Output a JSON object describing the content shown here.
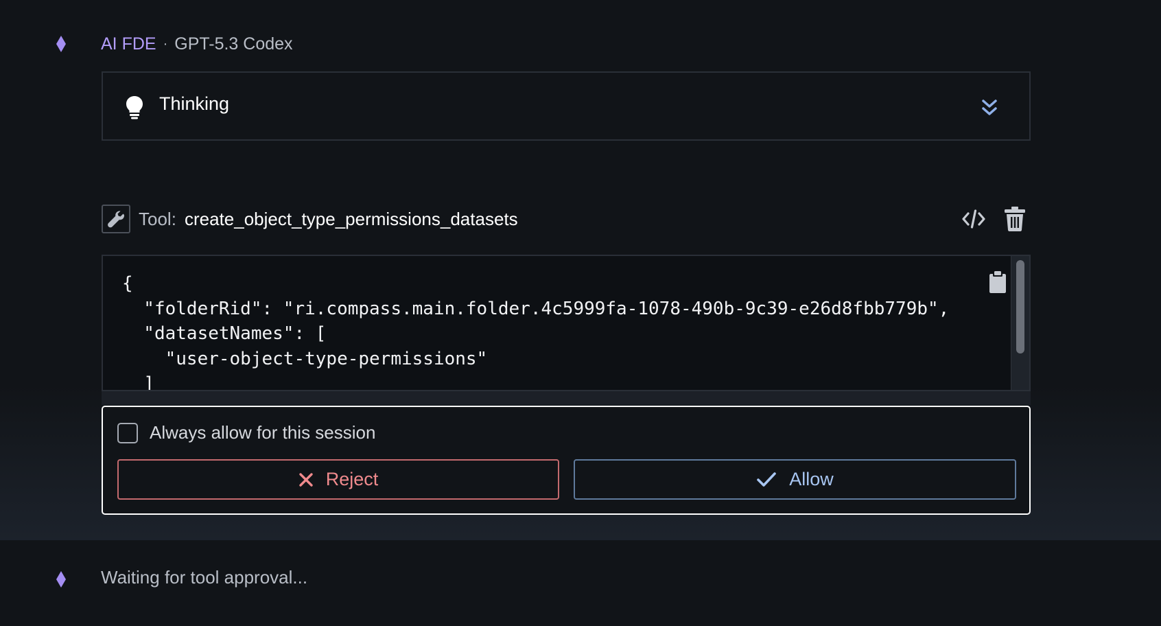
{
  "message": {
    "agent_name": "AI FDE",
    "separator": "·",
    "model_name": "GPT-5.3 Codex"
  },
  "thinking": {
    "label": "Thinking",
    "icon": "lightbulb-icon",
    "toggle_icon": "double-chevron-down-icon"
  },
  "tool": {
    "prefix": "Tool:",
    "name": "create_object_type_permissions_datasets",
    "icons": [
      "wrench-icon",
      "code-icon",
      "trash-icon",
      "clipboard-icon"
    ],
    "arguments_json": "{\n  \"folderRid\": \"ri.compass.main.folder.4c5999fa-1078-490b-9c39-e26d8fbb779b\",\n  \"datasetNames\": [\n    \"user-object-type-permissions\"\n  ]\n}"
  },
  "approval": {
    "always_allow_label": "Always allow for this session",
    "always_allow_checked": false,
    "reject_label": "Reject",
    "allow_label": "Allow"
  },
  "status": {
    "waiting_text": "Waiting for tool approval..."
  },
  "colors": {
    "background": "#111418",
    "accent_purple": "#b39dfa",
    "reject": "#f08a8d",
    "allow": "#a8c6f2"
  }
}
